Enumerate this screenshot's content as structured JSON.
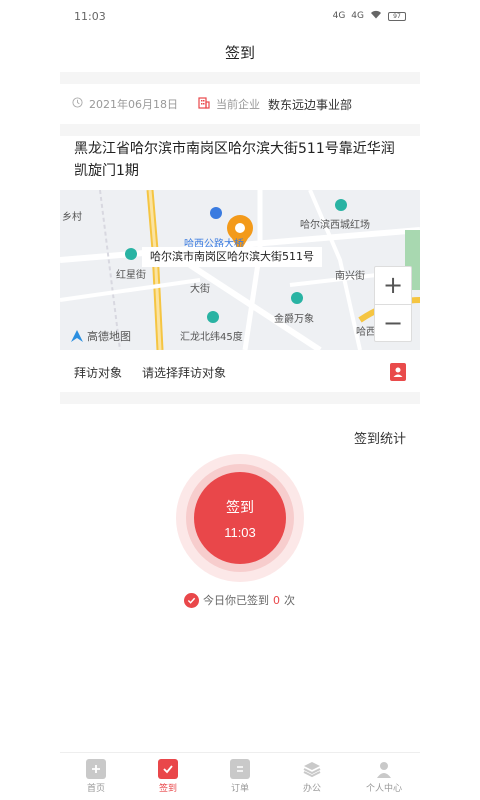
{
  "status_bar": {
    "time": "11:03",
    "signal_1": "4G",
    "signal_2": "4G",
    "battery": "97"
  },
  "header": {
    "title": "签到"
  },
  "info": {
    "date": "2021年06月18日",
    "company_label": "当前企业",
    "company_name": "数东远边事业部"
  },
  "address": {
    "text": "黑龙江省哈尔滨市南岗区哈尔滨大街511号靠近华润凯旋门1期"
  },
  "map": {
    "callout": "哈尔滨市南岗区哈尔滨大街511号",
    "labels": {
      "village": "乡村",
      "xidaqiao": "哈西公路大桥",
      "hongxing": "红星街",
      "mall": "哈尔滨西城红场",
      "nanxing": "南兴街",
      "dajie": "大街",
      "jinyue": "金爵万象",
      "huilong": "汇龙北纬45度",
      "harxi_dajie": "哈西大街"
    },
    "zoom_in": "+",
    "zoom_out": "−",
    "logo": "高德地图"
  },
  "visit": {
    "label": "拜访对象",
    "placeholder": "请选择拜访对象"
  },
  "stats": {
    "link": "签到统计"
  },
  "sign": {
    "label": "签到",
    "time": "11:03"
  },
  "sign_count": {
    "prefix": "今日你已签到",
    "count": "0",
    "suffix": "次"
  },
  "colors": {
    "accent": "#e9474a",
    "gap": "#f5f5f5"
  },
  "tabs": [
    {
      "label": "首页",
      "icon": "home-icon"
    },
    {
      "label": "签到",
      "icon": "calendar-check-icon"
    },
    {
      "label": "订单",
      "icon": "order-icon"
    },
    {
      "label": "办公",
      "icon": "layers-icon"
    },
    {
      "label": "个人中心",
      "icon": "user-icon"
    }
  ]
}
